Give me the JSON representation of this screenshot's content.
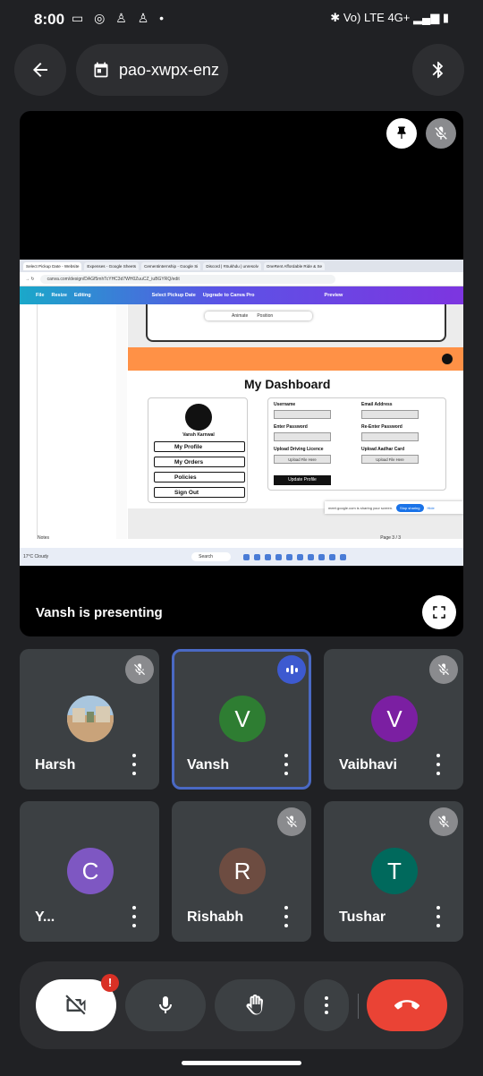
{
  "status_bar": {
    "time": "8:00",
    "left_icons": [
      "video-icon",
      "whatsapp-icon",
      "snapchat-icon",
      "snapchat-icon",
      "dot"
    ],
    "network": "Vo) LTE 4G+",
    "right_icons": [
      "bluetooth-vibrate-icon",
      "signal-icon",
      "battery-icon"
    ]
  },
  "top_bar": {
    "meeting_code": "pao-xwpx-enz",
    "back_icon": "arrow-left-icon",
    "calendar_icon": "calendar-icon",
    "bluetooth_icon": "bluetooth-icon"
  },
  "presentation": {
    "label": "Vansh is presenting",
    "shared_screen": {
      "tabs": [
        "Select Pickup Date - Website",
        "Expenses - Google Sheets",
        "Cementinternship - Google Si",
        "Discord | #Sukhdu | unresolv",
        "OneRent Affordable Ride & Se"
      ],
      "url": "canva.com/design/DAGf5mhTcYHC3d7WH0ZuuCZ_iuBGYRQ/edit",
      "canva_menu": [
        "File",
        "Resize",
        "Editing",
        "Select Pickup Date",
        "Upgrade to Canva Pro",
        "Preview"
      ],
      "toolbar": [
        "Animate",
        "Position"
      ],
      "dashboard_title": "My Dashboard",
      "user_name": "Vansh Karnwal",
      "menu_items": [
        "My Profile",
        "My Orders",
        "Policies",
        "Sign Out"
      ],
      "form_labels": [
        "Username",
        "Email Address",
        "Enter Password",
        "Re-Enter Password",
        "Upload  Driving Licence",
        "Upload  Aadhar Card"
      ],
      "upload_labels": [
        "Upload File Here",
        "Upload File Here"
      ],
      "update_button": "Update Profile",
      "share_notice": "meet.google.com is sharing your screen.",
      "stop_sharing": "Stop sharing",
      "hide": "Hide",
      "notes": "Notes",
      "page_info": "Page 3 / 3",
      "weather": "17°C Cloudy",
      "taskbar_search": "Search"
    }
  },
  "participants": [
    {
      "name": "Harsh",
      "initial": "",
      "color": "",
      "status": "muted",
      "photo": true
    },
    {
      "name": "Vansh",
      "initial": "V",
      "color": "#2e7d32",
      "status": "speaking",
      "photo": false
    },
    {
      "name": "Vaibhavi",
      "initial": "V",
      "color": "#7b1fa2",
      "status": "muted",
      "photo": false
    },
    {
      "name": "Y...",
      "initial": "C",
      "color": "#7e57c2",
      "status": "none",
      "photo": false
    },
    {
      "name": "Rishabh",
      "initial": "R",
      "color": "#6d4c41",
      "status": "muted",
      "photo": false
    },
    {
      "name": "Tushar",
      "initial": "T",
      "color": "#00695c",
      "status": "muted",
      "photo": false
    }
  ],
  "controls": {
    "camera_badge": "!",
    "buttons": [
      "camera-off",
      "microphone",
      "raise-hand",
      "more-options",
      "end-call"
    ],
    "end_call_color": "#ea4335"
  }
}
